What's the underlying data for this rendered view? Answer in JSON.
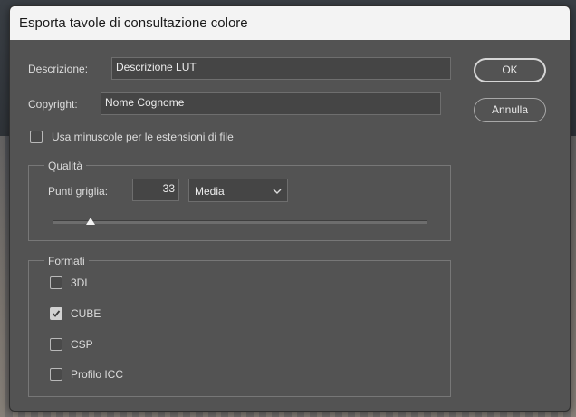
{
  "window": {
    "title": "Esporta tavole di consultazione colore"
  },
  "fields": {
    "description_label": "Descrizione:",
    "description_value": "Descrizione LUT",
    "copyright_label": "Copyright:",
    "copyright_value": "Nome Cognome"
  },
  "buttons": {
    "ok": "OK",
    "cancel": "Annulla"
  },
  "lowercase_ext": {
    "label": "Usa minuscole per le estensioni di file",
    "checked": false
  },
  "quality": {
    "title": "Qualità",
    "grid_points_label": "Punti griglia:",
    "grid_points_value": "33",
    "preset": "Media",
    "slider_level": 0.1
  },
  "formats": {
    "title": "Formati",
    "items": [
      {
        "label": "3DL",
        "checked": false
      },
      {
        "label": "CUBE",
        "checked": true
      },
      {
        "label": "CSP",
        "checked": false
      },
      {
        "label": "Profilo ICC",
        "checked": false
      }
    ]
  },
  "icons": {
    "check": "check-icon",
    "dropdown": "chevron-down-icon"
  }
}
